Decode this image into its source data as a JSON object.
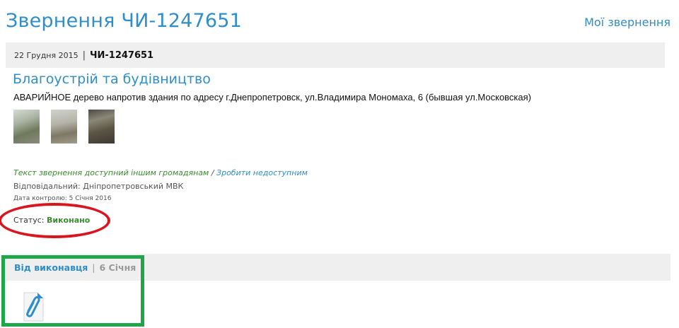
{
  "header": {
    "title": "Звернення ЧИ-1247651",
    "my_requests_link": "Мої звернення"
  },
  "meta": {
    "date": "22 Грудня 2015",
    "separator": "|",
    "number": "ЧИ-1247651"
  },
  "request": {
    "category": "Благоустрій та будівництво",
    "description": "АВАРИЙНОЕ дерево напротив здания по адресу г.Днепропетровск, ул.Владимира Мономаха, 6 (бывшая ул.Московская)",
    "photos": [
      {
        "name": "photo-1"
      },
      {
        "name": "photo-2"
      },
      {
        "name": "photo-3"
      }
    ],
    "public_text": "Текст звернення доступний іншим громадянам",
    "public_separator": " / ",
    "make_private_link": "Зробити недоступним",
    "responsible": "Відповідальний: Дніпропетровський МВК",
    "control_date": "Дата контролю: 5 Січня 2016",
    "status_label": "Статус: ",
    "status_value": "Виконано"
  },
  "response": {
    "from_label": "Від виконавця",
    "separator": "|",
    "date": "6 Січня",
    "attachment_icon": "paperclip-document-icon"
  },
  "colors": {
    "accent": "#2f8ec9",
    "status_green": "#3a8c2f",
    "highlight_red": "#d9161f",
    "highlight_green": "#1fa64a",
    "bar_bg": "#efefef"
  }
}
